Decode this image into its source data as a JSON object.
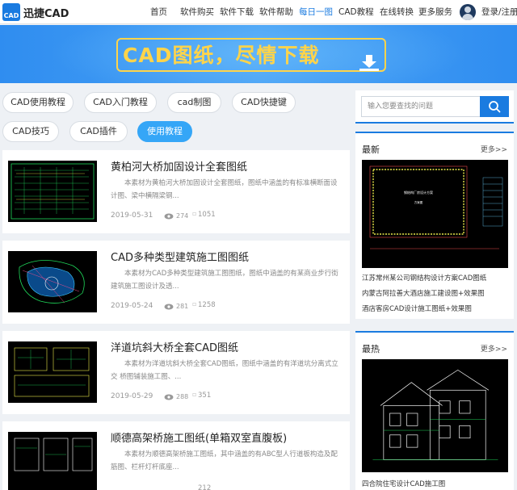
{
  "header": {
    "logo_mark": "CAD",
    "logo_text": "迅捷CAD",
    "nav": [
      {
        "label": "首页",
        "active": false
      },
      {
        "label": "软件购买",
        "active": false
      },
      {
        "label": "软件下载",
        "active": false
      },
      {
        "label": "软件帮助",
        "active": false
      },
      {
        "label": "每日一图",
        "active": true
      },
      {
        "label": "CAD教程",
        "active": false
      },
      {
        "label": "在线转换",
        "active": false
      },
      {
        "label": "更多服务",
        "active": false
      }
    ],
    "login": "登录/注册"
  },
  "banner": {
    "title": "CAD图纸，尽情下载"
  },
  "tags": [
    {
      "label": "CAD使用教程",
      "active": false
    },
    {
      "label": "CAD入门教程",
      "active": false
    },
    {
      "label": "cad制图",
      "active": false
    },
    {
      "label": "CAD快捷键",
      "active": false
    },
    {
      "label": "CAD技巧",
      "active": false
    },
    {
      "label": "CAD插件",
      "active": false
    },
    {
      "label": "使用教程",
      "active": true
    }
  ],
  "articles": [
    {
      "title": "黄柏河大桥加固设计全套图纸",
      "desc": "本素材为黄柏河大桥加固设计全套图纸，图纸中涵盖的有标准横断面设计图、梁中横隔梁钢...",
      "date": "2019-05-31",
      "views": "274",
      "comments": "1051"
    },
    {
      "title": "CAD多种类型建筑施工图图纸",
      "desc": "本素材为CAD多种类型建筑施工图图纸，图纸中涵盖的有某商业步行街建筑施工图设计及透...",
      "date": "2019-05-24",
      "views": "281",
      "comments": "1258"
    },
    {
      "title": "洋道坑斜大桥全套CAD图纸",
      "desc": "本素材为洋道坑斜大桥全套CAD图纸，图纸中涵盖的有洋道坑分离式立交 桥图铺装施工图、...",
      "date": "2019-05-29",
      "views": "288",
      "comments": "351"
    },
    {
      "title": "顺德高架桥施工图纸(单箱双室直腹板)",
      "desc": "本素材为顺德高架桥施工图纸，其中涵盖的有ABC型人行道板构造及配筋图、栏杆灯杆底座...",
      "date": "",
      "views": "",
      "comments": "212"
    }
  ],
  "search": {
    "placeholder": "输入您要查找的问题"
  },
  "latest": {
    "title": "最新",
    "more": "更多>>",
    "links": [
      "江苏常州某公司钢结构设计方案CAD图纸",
      "内蒙古阿拉善大酒店施工建设图+效果图",
      "酒店客房CAD设计施工图纸+效果图"
    ]
  },
  "hottest": {
    "title": "最热",
    "more": "更多>>",
    "links": [
      "四合院住宅设计CAD施工图"
    ]
  },
  "colors": {
    "brand_blue": "#1a7be0",
    "tag_active": "#35a6f7",
    "banner_gold": "#ffd44a",
    "cad_green": "#1fd85a"
  }
}
